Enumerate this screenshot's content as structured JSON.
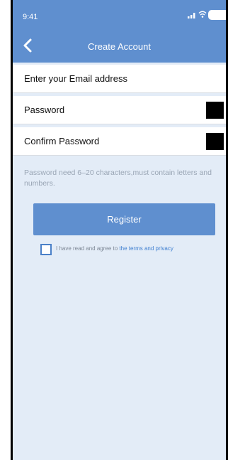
{
  "status_bar": {
    "time": "9:41",
    "icons": [
      "signal-icon",
      "wifi-icon",
      "battery-icon"
    ]
  },
  "header": {
    "title": "Create Account",
    "back_icon": "chevron-left-icon"
  },
  "form": {
    "email_placeholder": "Enter your Email address",
    "password_placeholder": "Password",
    "confirm_password_placeholder": "Confirm Password"
  },
  "hint_text": "Password need 6–20 characters,must contain letters and numbers.",
  "register_label": "Register",
  "agreement": {
    "text": "I have read and agree to ",
    "link_text": "the terms and privacy",
    "checked": false
  },
  "colors": {
    "accent": "#5f8fcf",
    "background": "#e3ecf7",
    "link": "#3f7fd0"
  }
}
